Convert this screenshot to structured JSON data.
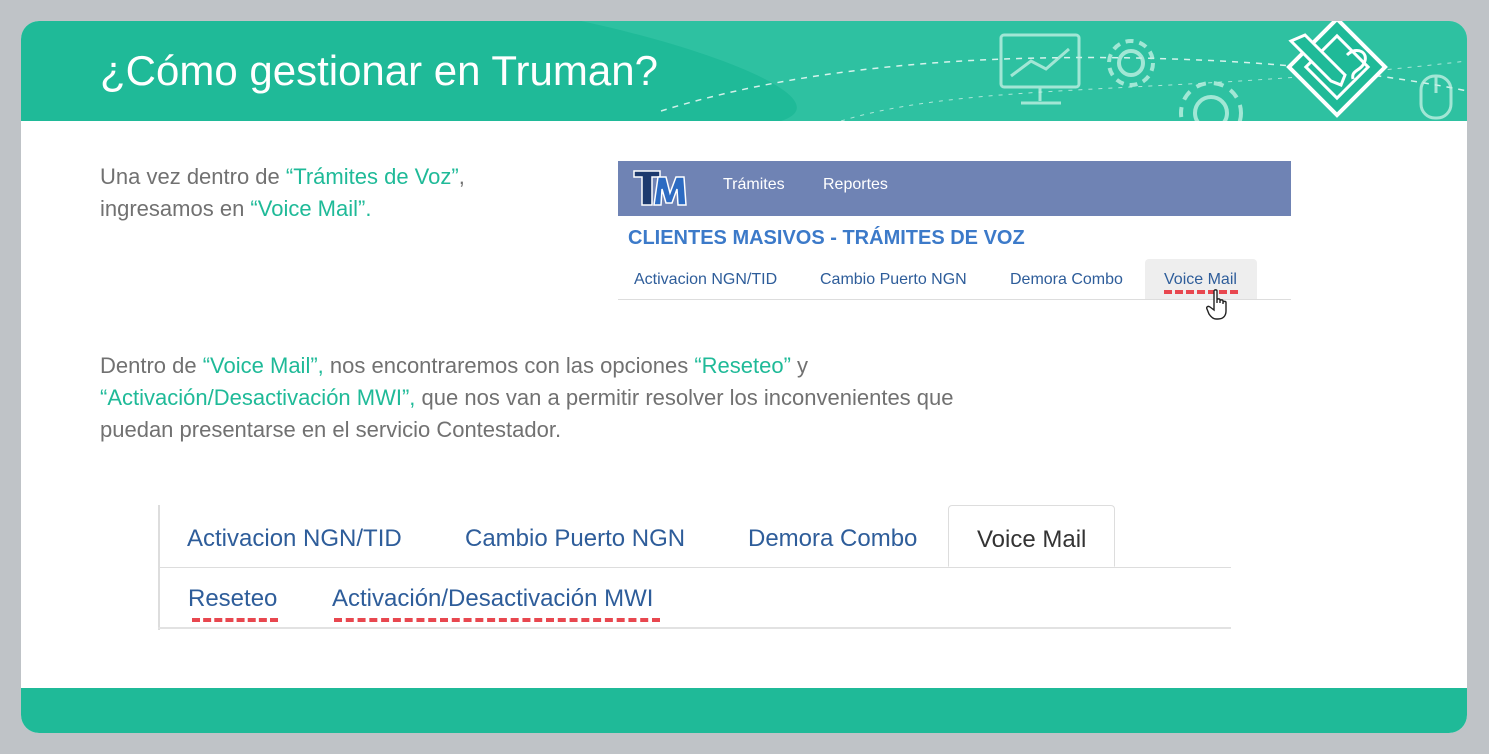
{
  "slide": {
    "title": "¿Cómo gestionar en Truman?",
    "colors": {
      "accent": "#1fba98",
      "text_gray": "#717171",
      "navbar": "#6f83b4",
      "link": "#2e5d9a",
      "dash": "#e8474f"
    }
  },
  "intro": {
    "part1": "Una vez dentro de ",
    "hl1": "“Trámites de Voz”",
    "part2": ",",
    "part3": "ingresamos en ",
    "hl2": "“Voice Mail”."
  },
  "truman_screen": {
    "logo_alt": "TM",
    "nav": [
      "Trámites",
      "Reportes"
    ],
    "section_title": "CLIENTES MASIVOS - TRÁMITES DE VOZ",
    "tabs": [
      "Activacion NGN/TID",
      "Cambio Puerto NGN",
      "Demora Combo",
      "Voice Mail"
    ],
    "active_tab": "Voice Mail",
    "cursor_icon": "hand-pointer-icon"
  },
  "detail": {
    "p1": "Dentro de ",
    "hl1": "“Voice Mail”,",
    "p2": " nos encontraremos con las opciones ",
    "hl2": "“Reseteo”",
    "p3": " y",
    "hl3": "“Activación/Desactivación MWI”,",
    "p4": " que nos van a permitir resolver los inconvenientes que",
    "p5": "puedan presentarse en el servicio Contestador."
  },
  "tabs_zoom": {
    "tabs": [
      "Activacion NGN/TID",
      "Cambio Puerto NGN",
      "Demora Combo",
      "Voice Mail"
    ],
    "active_tab": "Voice Mail",
    "subtabs": [
      "Reseteo",
      "Activación/Desactivación MWI"
    ]
  },
  "icons": [
    "monitor-chart-icon",
    "gear-icon",
    "pencil-badge-icon",
    "mouse-icon"
  ]
}
